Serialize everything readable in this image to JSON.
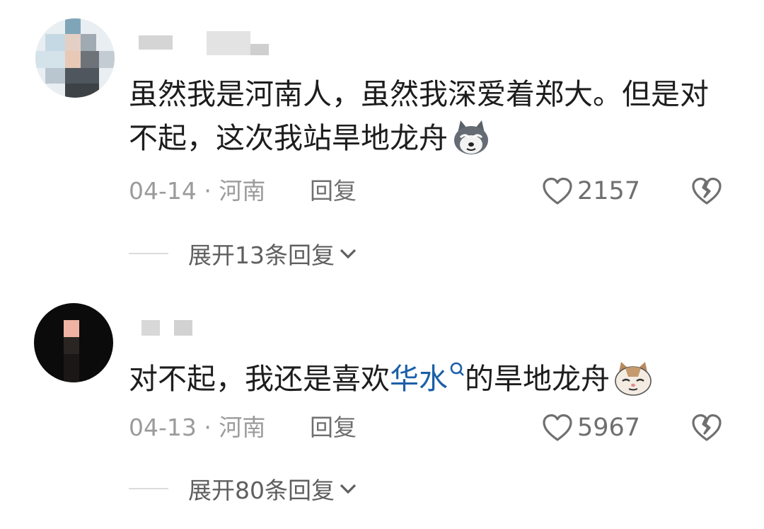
{
  "comments": [
    {
      "text": "虽然我是河南人，虽然我深爱着郑大。但是对不起，这次我站旱地龙舟",
      "emoji": "husky-dog-emoji",
      "date_location": "04-14 · 河南",
      "reply_label": "回复",
      "likes": "2157",
      "expand_label": "展开13条回复"
    },
    {
      "text_before": "对不起，我还是喜欢",
      "highlight": "华水",
      "text_after": "的旱地龙舟",
      "emoji": "cat-emoji",
      "date_location": "04-13 · 河南",
      "reply_label": "回复",
      "likes": "5967",
      "expand_label": "展开80条回复"
    }
  ],
  "colors": {
    "highlight": "#1b5fa8",
    "meta": "#9b9b9b",
    "icon": "#6f6f6f"
  }
}
